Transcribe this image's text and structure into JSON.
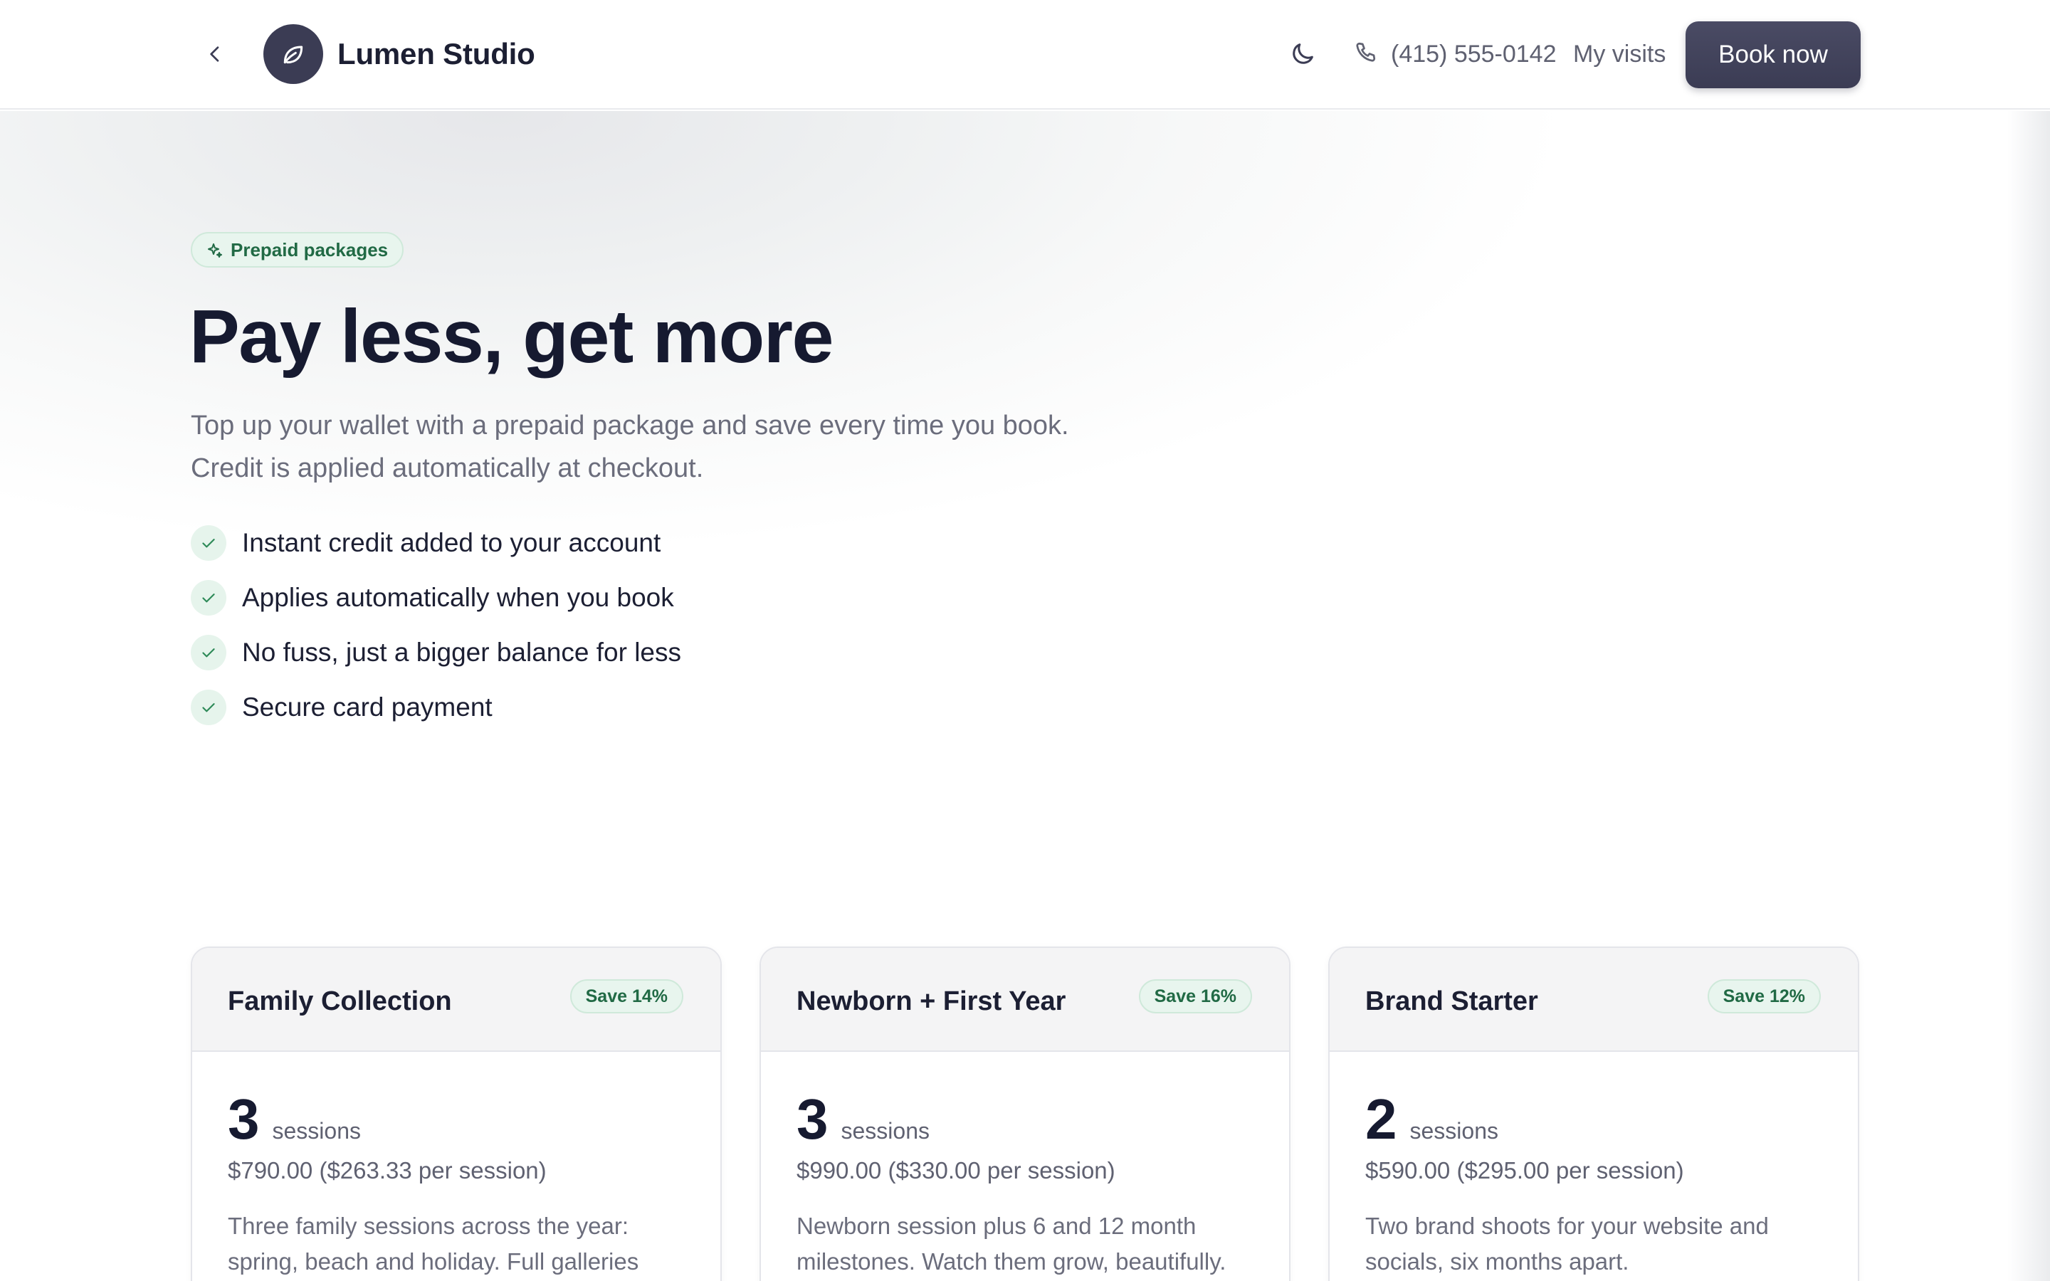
{
  "header": {
    "brand": "Lumen Studio",
    "phone": "(415) 555-0142",
    "visits_label": "My visits",
    "book_label": "Book now"
  },
  "hero": {
    "badge": "Prepaid packages",
    "title": "Pay less, get more",
    "subtitle_line1": "Top up your wallet with a prepaid package and save every time you book.",
    "subtitle_line2": "Credit is applied automatically at checkout.",
    "features": [
      "Instant credit added to your account",
      "Applies automatically when you book",
      "No fuss, just a bigger balance for less",
      "Secure card payment"
    ]
  },
  "packages": [
    {
      "title": "Family Collection",
      "save": "Save 14%",
      "sessions": "3",
      "unit": "sessions",
      "price": "$790.00 ($263.33 per session)",
      "description": "Three family sessions across the year: spring, beach and holiday. Full galleries"
    },
    {
      "title": "Newborn + First Year",
      "save": "Save 16%",
      "sessions": "3",
      "unit": "sessions",
      "price": "$990.00 ($330.00 per session)",
      "description": "Newborn session plus 6 and 12 month milestones. Watch them grow, beautifully."
    },
    {
      "title": "Brand Starter",
      "save": "Save 12%",
      "sessions": "2",
      "unit": "sessions",
      "price": "$590.00 ($295.00 per session)",
      "description": "Two brand shoots for your website and socials, six months apart."
    }
  ],
  "colors": {
    "primary": "#3b3c54",
    "accent_green": "#216a45",
    "pill_bg": "#e8f5ee",
    "text": "#1c1f33",
    "muted": "#6b6d7c"
  }
}
